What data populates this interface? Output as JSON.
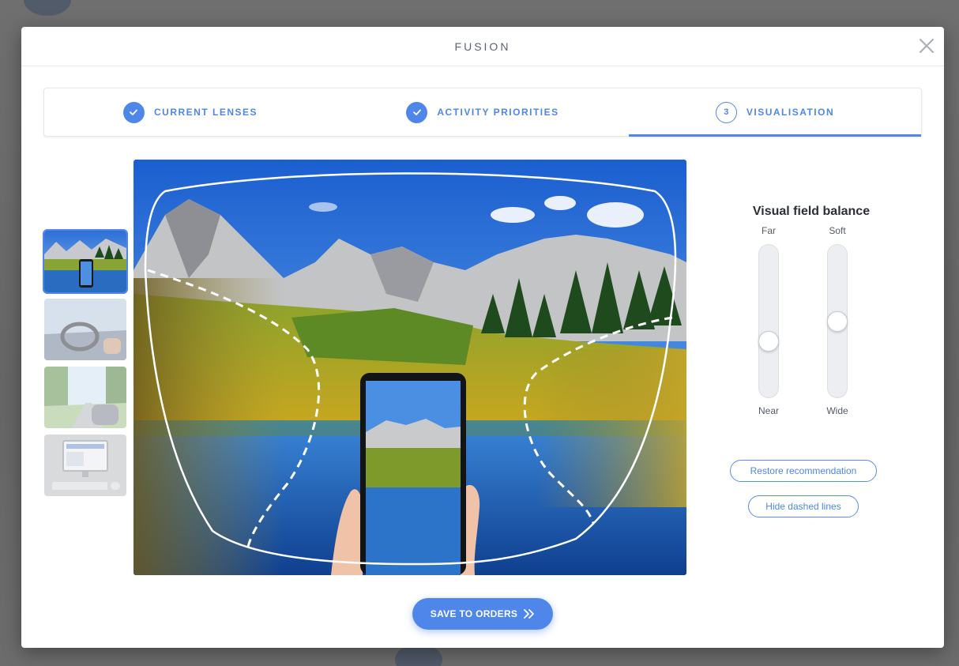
{
  "modal": {
    "title": "FUSION",
    "close_icon": "close-icon"
  },
  "stepper": {
    "steps": [
      {
        "label": "CURRENT LENSES",
        "state": "done",
        "icon": "check-icon"
      },
      {
        "label": "ACTIVITY PRIORITIES",
        "state": "done",
        "icon": "check-icon"
      },
      {
        "label": "VISUALISATION",
        "state": "active",
        "number": "3"
      }
    ]
  },
  "thumbnails": [
    {
      "name": "mountain-lake-phone",
      "selected": true
    },
    {
      "name": "car-driving",
      "selected": false
    },
    {
      "name": "cycling-park",
      "selected": false
    },
    {
      "name": "computer-desk",
      "selected": false
    }
  ],
  "controls": {
    "title": "Visual field balance",
    "distance_slider": {
      "top_label": "Far",
      "bottom_label": "Near",
      "value": 0.35
    },
    "softness_slider": {
      "top_label": "Soft",
      "bottom_label": "Wide",
      "value": 0.5
    },
    "restore_label": "Restore recommendation",
    "hide_lines_label": "Hide dashed lines"
  },
  "save": {
    "label": "SAVE TO ORDERS",
    "icon": "double-chevron-right-icon"
  },
  "colors": {
    "accent": "#4f86ea",
    "title_text": "#2c2f36"
  }
}
